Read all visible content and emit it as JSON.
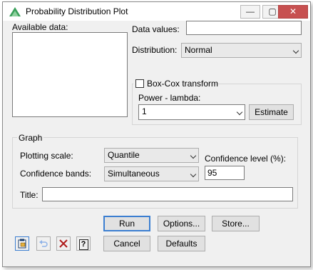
{
  "window": {
    "title": "Probability Distribution Plot"
  },
  "title_buttons": {
    "minimize": "—",
    "maximize": "▢",
    "close": "✕"
  },
  "available_data": {
    "label": "Available data:"
  },
  "data_values": {
    "label": "Data values:",
    "value": ""
  },
  "distribution": {
    "label": "Distribution:",
    "value": "Normal"
  },
  "boxcox": {
    "label": "Box-Cox transform",
    "checked": false,
    "power_label": "Power - lambda:",
    "power_value": "1",
    "estimate_label": "Estimate"
  },
  "graph": {
    "legend": "Graph",
    "plotting_scale_label": "Plotting scale:",
    "plotting_scale_value": "Quantile",
    "confidence_bands_label": "Confidence bands:",
    "confidence_bands_value": "Simultaneous",
    "confidence_level_label": "Confidence level (%):",
    "confidence_level_value": "95",
    "title_label": "Title:",
    "title_value": ""
  },
  "buttons": {
    "run": "Run",
    "options": "Options...",
    "store": "Store...",
    "cancel": "Cancel",
    "defaults": "Defaults"
  },
  "toolbar": {
    "icons": [
      "clipboard-icon",
      "undo-icon",
      "clear-icon",
      "help-icon"
    ],
    "help_glyph": "?"
  },
  "colors": {
    "accent": "#3c7fd1",
    "close": "#c75050"
  }
}
